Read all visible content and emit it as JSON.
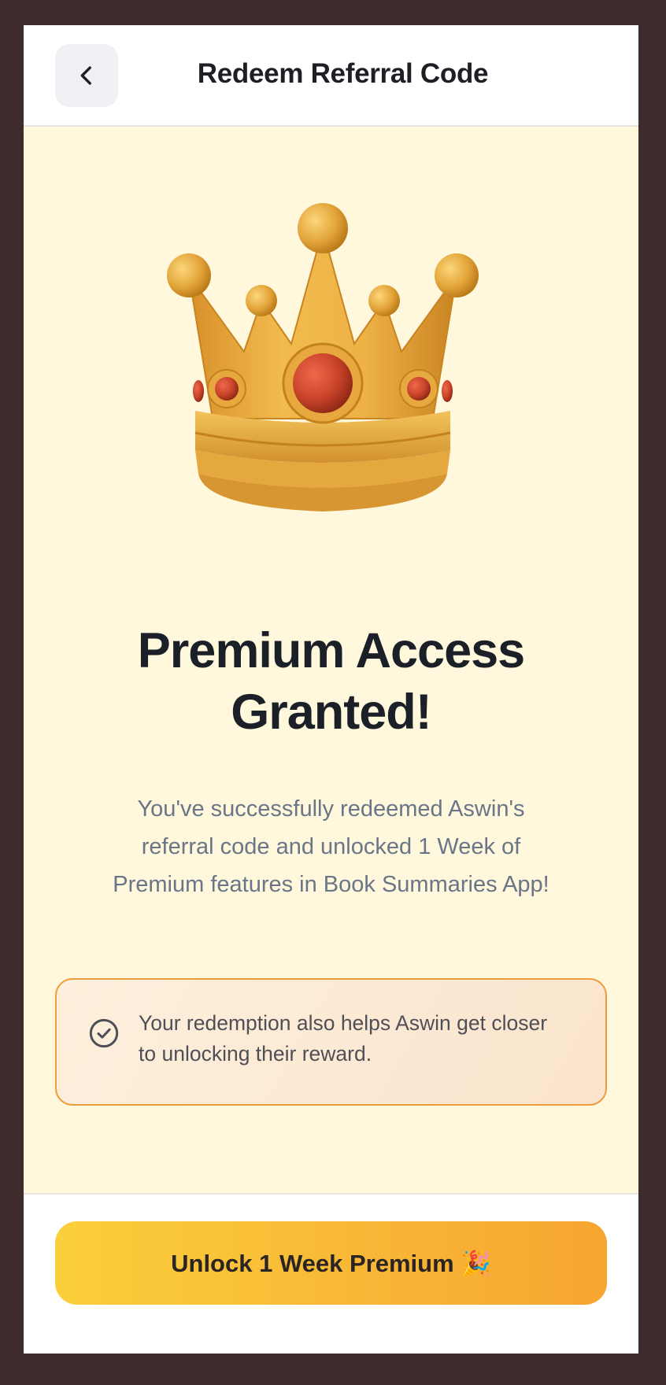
{
  "header": {
    "title": "Redeem Referral Code",
    "back_icon": "chevron-left-icon"
  },
  "hero": {
    "image": "crown-illustration",
    "colors": {
      "gold": "#e3a53a",
      "gem": "#c9432a"
    }
  },
  "main": {
    "headline": "Premium Access Granted!",
    "description": "You've successfully redeemed Aswin's referral code and unlocked 1 Week of Premium features in Book Summaries App!"
  },
  "info": {
    "icon": "check-circle-icon",
    "text": "Your redemption also helps Aswin get closer to unlocking their reward."
  },
  "cta": {
    "label": "Unlock 1 Week Premium 🎉"
  },
  "colors": {
    "background": "#fff8dc",
    "accent_start": "#fbcf3c",
    "accent_end": "#f6a531",
    "info_border": "#ef9b3b",
    "frame": "#3e2c2c"
  }
}
